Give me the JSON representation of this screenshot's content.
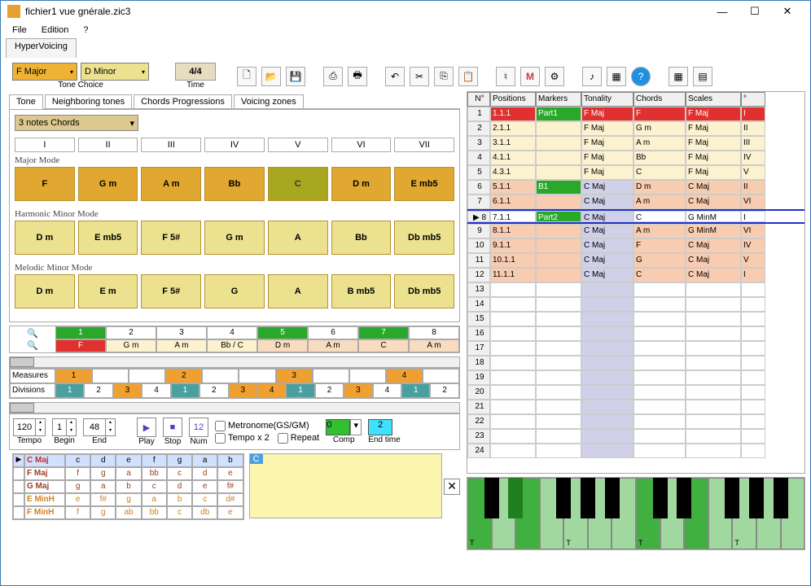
{
  "window": {
    "title": "fichier1 vue gnérale.zic3"
  },
  "menu": {
    "file": "File",
    "edition": "Edition",
    "help": "?"
  },
  "main_tab": "HyperVoicing",
  "tone_combo": "F Major",
  "minor_combo": "D Minor",
  "tone_label": "Tone Choice",
  "time_value": "4/4",
  "time_label": "Time",
  "subtabs": [
    "Tone",
    "Neighboring tones",
    "Chords Progressions",
    "Voicing zones"
  ],
  "chord_type": "3 notes Chords",
  "romans": [
    "I",
    "II",
    "III",
    "IV",
    "V",
    "VI",
    "VII"
  ],
  "mode_major": "Major Mode",
  "major_chords": [
    "F",
    "G m",
    "A m",
    "Bb",
    "C",
    "D m",
    "E mb5"
  ],
  "mode_harm": "Harmonic Minor Mode",
  "harm_chords": [
    "D m",
    "E mb5",
    "F 5#",
    "G m",
    "A",
    "Bb",
    "Db mb5"
  ],
  "mode_mel": "Melodic Minor Mode",
  "mel_chords": [
    "D m",
    "E m",
    "F 5#",
    "G",
    "A",
    "B mb5",
    "Db mb5"
  ],
  "seq_nums": [
    "1",
    "2",
    "3",
    "4",
    "5",
    "6",
    "7",
    "8"
  ],
  "seq_chords": [
    "F",
    "G m",
    "A m",
    "Bb / C",
    "D m",
    "A m",
    "C",
    "A m"
  ],
  "measures_label": "Measures",
  "divisions_label": "Divisions",
  "meas_row": [
    "1",
    "",
    "",
    "2",
    "",
    "",
    "3",
    "",
    "",
    "4",
    ""
  ],
  "div_row": [
    "1",
    "2",
    "3",
    "4",
    "1",
    "2",
    "3",
    "4",
    "1",
    "2",
    "3",
    "4",
    "1",
    "2"
  ],
  "div_hl": [
    0,
    2,
    4,
    6,
    7,
    8,
    10,
    12
  ],
  "play": {
    "tempo_v": "120",
    "tempo_l": "Tempo",
    "begin_v": "1",
    "begin_l": "Begin",
    "end_v": "48",
    "end_l": "End",
    "play_l": "Play",
    "stop_l": "Stop",
    "num_l": "Num",
    "num_v": "12",
    "metro": "Metronome(GS/GM)",
    "tempox2": "Tempo x 2",
    "repeat": "Repeat",
    "comp_l": "Comp",
    "comp_v": "0",
    "endtime_l": "End time",
    "endtime_v": "2"
  },
  "chord_notes": [
    {
      "name": "C Maj",
      "cls": "red",
      "notes": [
        "c",
        "d",
        "e",
        "f",
        "g",
        "a",
        "b"
      ]
    },
    {
      "name": "F Maj",
      "cls": "maroon",
      "notes": [
        "f",
        "g",
        "a",
        "bb",
        "c",
        "d",
        "e"
      ]
    },
    {
      "name": "G Maj",
      "cls": "maroon",
      "notes": [
        "g",
        "a",
        "b",
        "c",
        "d",
        "e",
        "f#"
      ]
    },
    {
      "name": "E MinH",
      "cls": "or",
      "notes": [
        "e",
        "f#",
        "g",
        "a",
        "b",
        "c",
        "d#"
      ]
    },
    {
      "name": "F MinH",
      "cls": "or",
      "notes": [
        "f",
        "g",
        "ab",
        "bb",
        "c",
        "db",
        "e"
      ]
    }
  ],
  "yellow_label": "C",
  "grid_headers": [
    "N°",
    "Positions",
    "Markers",
    "Tonality",
    "Chords",
    "Scales",
    "°"
  ],
  "grid_rows": [
    {
      "n": "1",
      "pos": "1.1.1",
      "mk": "Part1",
      "ton": "F Maj",
      "ch": "F",
      "sc": "F Maj",
      "deg": "I",
      "cls": "r-red",
      "mkcls": "mk-green"
    },
    {
      "n": "2",
      "pos": "2.1.1",
      "mk": "",
      "ton": "F Maj",
      "ch": "G m",
      "sc": "F Maj",
      "deg": "II",
      "cls": "r-cream"
    },
    {
      "n": "3",
      "pos": "3.1.1",
      "mk": "",
      "ton": "F Maj",
      "ch": "A m",
      "sc": "F Maj",
      "deg": "III",
      "cls": "r-cream"
    },
    {
      "n": "4",
      "pos": "4.1.1",
      "mk": "",
      "ton": "F Maj",
      "ch": "Bb",
      "sc": "F Maj",
      "deg": "IV",
      "cls": "r-cream"
    },
    {
      "n": "5",
      "pos": "4.3.1",
      "mk": "",
      "ton": "F Maj",
      "ch": "C",
      "sc": "F Maj",
      "deg": "V",
      "cls": "r-cream"
    },
    {
      "n": "6",
      "pos": "5.1.1",
      "mk": "B1",
      "ton": "C Maj",
      "ch": "D m",
      "sc": "C Maj",
      "deg": "II",
      "cls": "r-peach",
      "mkcls": "mk-green",
      "lav": true
    },
    {
      "n": "7",
      "pos": "6.1.1",
      "mk": "",
      "ton": "C Maj",
      "ch": "A m",
      "sc": "C Maj",
      "deg": "VI",
      "cls": "r-peach",
      "lav": true
    },
    {
      "n": "8",
      "pos": "7.1.1",
      "mk": "Part2",
      "ton": "C Maj",
      "ch": "C",
      "sc": "G MinM",
      "deg": "I",
      "cls": "r-blue",
      "mkcls": "mk-green",
      "lav": true,
      "sel": true
    },
    {
      "n": "9",
      "pos": "8.1.1",
      "mk": "",
      "ton": "C Maj",
      "ch": "A m",
      "sc": "G MinM",
      "deg": "VI",
      "cls": "r-peach",
      "lav": true
    },
    {
      "n": "10",
      "pos": "9.1.1",
      "mk": "",
      "ton": "C Maj",
      "ch": "F",
      "sc": "C Maj",
      "deg": "IV",
      "cls": "r-peach",
      "lav": true
    },
    {
      "n": "11",
      "pos": "10.1.1",
      "mk": "",
      "ton": "C Maj",
      "ch": "G",
      "sc": "C Maj",
      "deg": "V",
      "cls": "r-peach",
      "lav": true
    },
    {
      "n": "12",
      "pos": "11.1.1",
      "mk": "",
      "ton": "C Maj",
      "ch": "C",
      "sc": "C Maj",
      "deg": "I",
      "cls": "r-peach",
      "lav": true
    }
  ],
  "empty_rows": [
    "13",
    "14",
    "15",
    "16",
    "17",
    "18",
    "19",
    "20",
    "21",
    "22",
    "23",
    "24"
  ],
  "piano_t": "T"
}
